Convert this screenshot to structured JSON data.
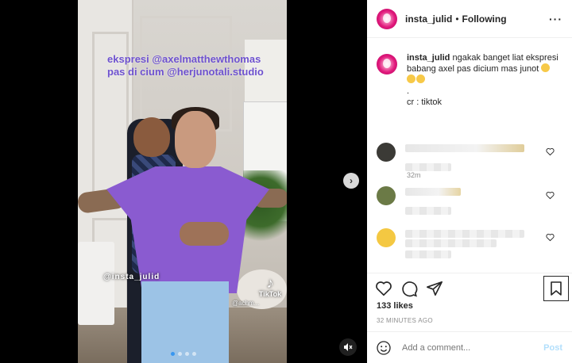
{
  "post": {
    "overlay_line1": "ekspresi @axelmatthewthomas",
    "overlay_line2": "pas di cium @herjunotali.studio",
    "watermark": "@insta_julid",
    "tiktok_label": "TikTok",
    "tiktok_handle": "@achm..."
  },
  "header": {
    "username": "insta_julid",
    "separator": "•",
    "follow_status": "Following",
    "more_icon": "more-dots-icon"
  },
  "caption": {
    "username": "insta_julid",
    "text": "ngakak banget liat ekspresi babang axel pas dicium mas junot",
    "dot_line": ".",
    "credit": "cr : tiktok",
    "time": "32m"
  },
  "comments": [
    {
      "avatar_color": "#3b3a36",
      "blurred": true
    },
    {
      "avatar_color": "#6b7a46",
      "blurred": true
    },
    {
      "avatar_color": "#f4c842",
      "blurred": true
    }
  ],
  "actions": {
    "likes": "133 likes",
    "time_ago": "32 MINUTES AGO",
    "comment_placeholder": "Add a comment...",
    "post_label": "Post"
  },
  "colors": {
    "overlay_text": "#6e52cf",
    "link_disabled": "#b2dffc",
    "shirt": "#8a5bd0"
  }
}
